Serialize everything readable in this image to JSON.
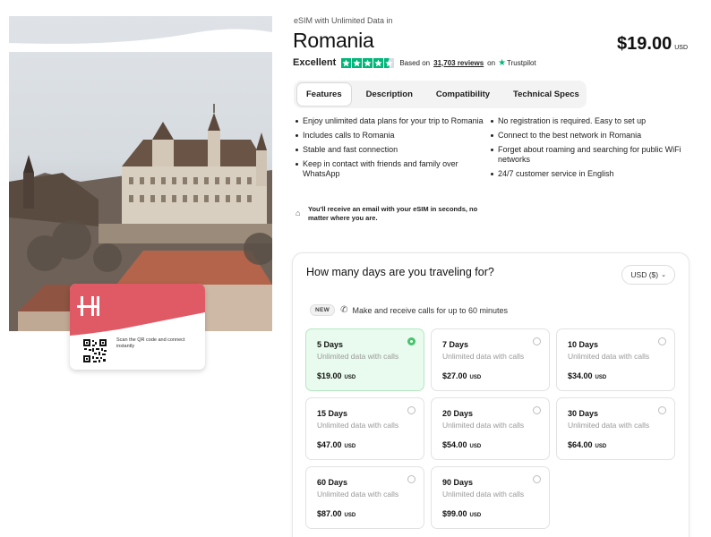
{
  "hero": {
    "card_brand_glyph": "H",
    "scan_text": "Scan the QR code and connect instantly"
  },
  "header": {
    "eyebrow": "eSIM with Unlimited Data in",
    "country": "Romania",
    "price": "$19.00",
    "price_currency": "USD"
  },
  "rating": {
    "label": "Excellent",
    "stars": 4.5,
    "based_on": "Based on",
    "reviews": "31,703 reviews",
    "on": "on",
    "provider": "Trustpilot",
    "star_color": "#00b67a"
  },
  "tabs": [
    {
      "label": "Features",
      "active": true
    },
    {
      "label": "Description",
      "active": false
    },
    {
      "label": "Compatibility",
      "active": false
    },
    {
      "label": "Technical Specs",
      "active": false
    }
  ],
  "features": {
    "left": [
      "Enjoy unlimited data plans for your trip to Romania",
      "Includes calls to Romania",
      "Stable and fast connection",
      "Keep in contact with friends and family over WhatsApp"
    ],
    "right": [
      "No registration is required. Easy to set up",
      "Connect to the best network in Romania",
      "Forget about roaming and searching for public WiFi networks",
      "24/7 customer service in English"
    ],
    "email_note": "You'll receive an email with your eSIM in seconds, no matter where you are."
  },
  "panel": {
    "title": "How many days are you traveling for?",
    "currency": "USD ($)",
    "new_badge": "NEW",
    "calls_note": "Make and receive calls for up to 60 minutes",
    "plans": [
      {
        "days": "5 Days",
        "desc": "Unlimited data with calls",
        "price": "$19.00",
        "currency": "USD",
        "selected": true
      },
      {
        "days": "7 Days",
        "desc": "Unlimited data with calls",
        "price": "$27.00",
        "currency": "USD",
        "selected": false
      },
      {
        "days": "10 Days",
        "desc": "Unlimited data with calls",
        "price": "$34.00",
        "currency": "USD",
        "selected": false
      },
      {
        "days": "15 Days",
        "desc": "Unlimited data with calls",
        "price": "$47.00",
        "currency": "USD",
        "selected": false
      },
      {
        "days": "20 Days",
        "desc": "Unlimited data with calls",
        "price": "$54.00",
        "currency": "USD",
        "selected": false
      },
      {
        "days": "30 Days",
        "desc": "Unlimited data with calls",
        "price": "$64.00",
        "currency": "USD",
        "selected": false
      },
      {
        "days": "60 Days",
        "desc": "Unlimited data with calls",
        "price": "$87.00",
        "currency": "USD",
        "selected": false
      },
      {
        "days": "90 Days",
        "desc": "Unlimited data with calls",
        "price": "$99.00",
        "currency": "USD",
        "selected": false
      }
    ]
  },
  "colors": {
    "brand_red": "#e05a66",
    "selected_bg": "#e9fbee",
    "selected_accent": "#46c46c"
  }
}
